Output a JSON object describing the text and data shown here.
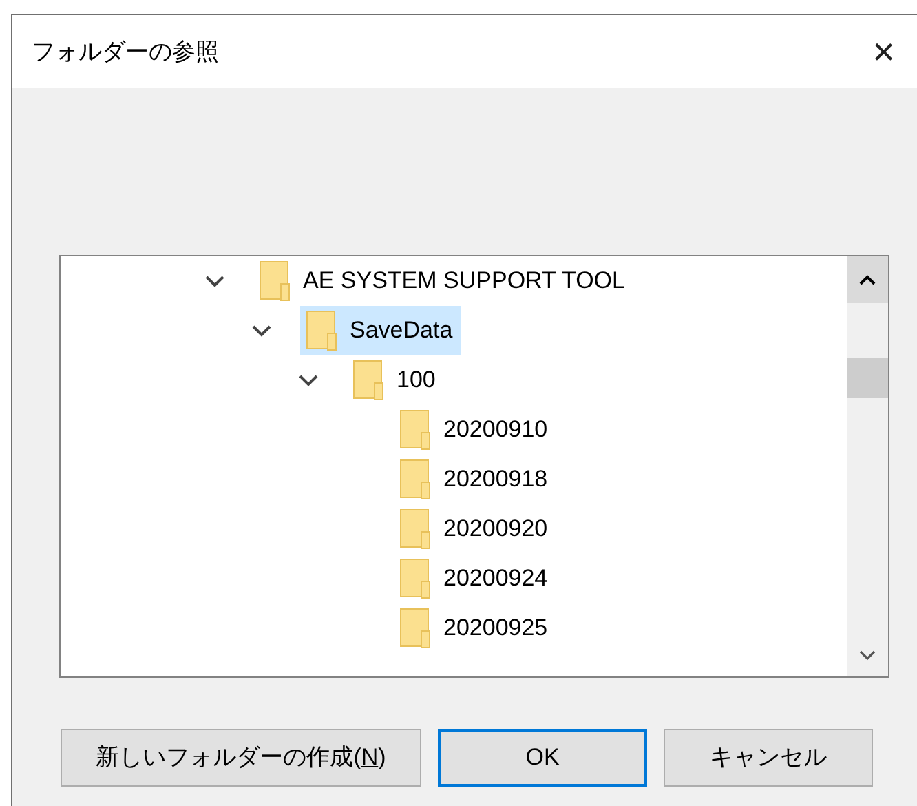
{
  "window": {
    "title": "フォルダーの参照",
    "close": "×"
  },
  "tree": [
    {
      "label": "AE SYSTEM SUPPORT TOOL",
      "expanded": true,
      "selected": false,
      "children": [
        {
          "label": "SaveData",
          "expanded": true,
          "selected": true,
          "children": [
            {
              "label": "100",
              "expanded": true,
              "selected": false,
              "children": [
                {
                  "label": "20200910",
                  "selected": false
                },
                {
                  "label": "20200918",
                  "selected": false
                },
                {
                  "label": "20200920",
                  "selected": false
                },
                {
                  "label": "20200924",
                  "selected": false
                },
                {
                  "label": "20200925",
                  "selected": false
                }
              ]
            }
          ]
        }
      ]
    }
  ],
  "buttons": [
    {
      "label_before": "新しいフォルダーの作成(",
      "access_key": "N",
      "label_after": ")",
      "default": false
    },
    {
      "label_before": "OK",
      "default": true
    },
    {
      "label_before": "キャンセル",
      "default": false
    }
  ]
}
